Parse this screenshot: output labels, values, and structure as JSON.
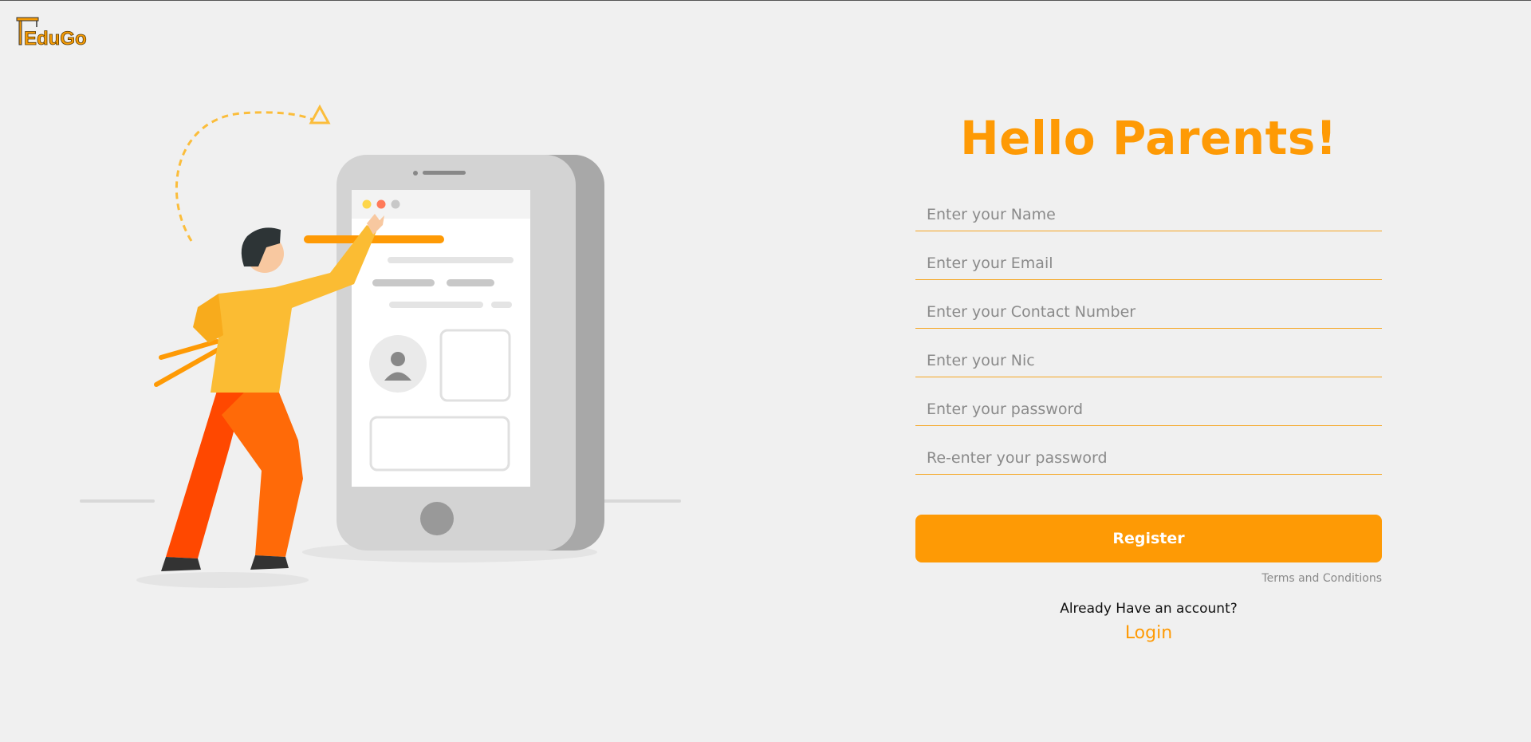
{
  "brand": {
    "logo_text": "EduGo",
    "accent_color": "#fe9a05"
  },
  "illustration": {
    "icon": "person-with-phone-illustration"
  },
  "form": {
    "title": "Hello Parents!",
    "fields": {
      "name_placeholder": "Enter your Name",
      "email_placeholder": "Enter your Email",
      "contact_placeholder": "Enter your Contact Number",
      "nic_placeholder": "Enter your Nic",
      "password_placeholder": "Enter your password",
      "repassword_placeholder": "Re-enter your password"
    },
    "register_label": "Register",
    "terms_label": "Terms and Conditions",
    "already_text": "Already Have an account?",
    "login_label": "Login"
  }
}
